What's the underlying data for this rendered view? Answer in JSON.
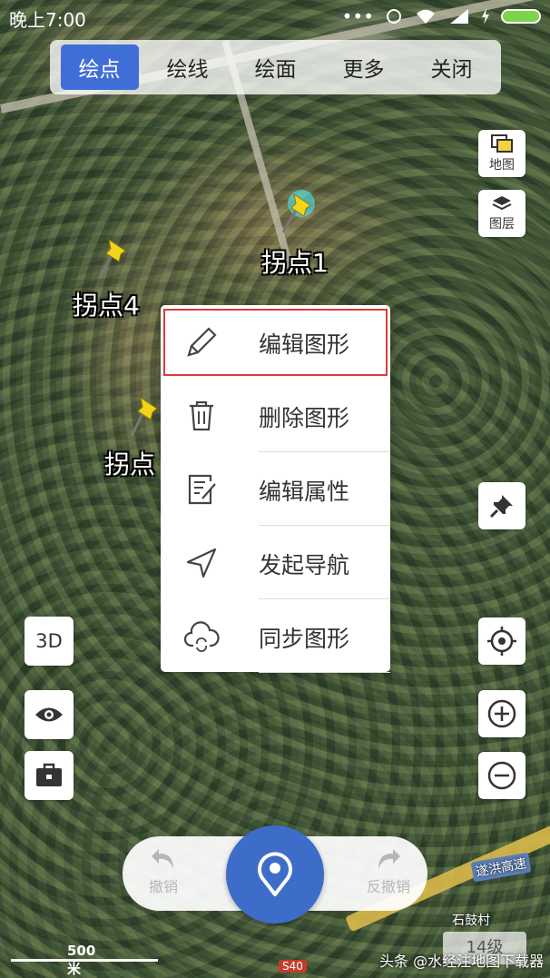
{
  "statusbar": {
    "time": "晚上7:00",
    "dots": "•••"
  },
  "toolbar": {
    "items": [
      "绘点",
      "绘线",
      "绘面",
      "更多",
      "关闭"
    ],
    "active_index": 0
  },
  "side": {
    "map_label": "地图",
    "layer_label": "图层"
  },
  "pins": [
    {
      "label": "拐点1"
    },
    {
      "label": "拐点4"
    },
    {
      "label": "拐点"
    }
  ],
  "menu": {
    "items": [
      "编辑图形",
      "删除图形",
      "编辑属性",
      "发起导航",
      "同步图形"
    ]
  },
  "left": {
    "three_d_label": "3D"
  },
  "bottom": {
    "undo_label": "撤销",
    "redo_label": "反撤销"
  },
  "scale_label": "500米",
  "zoom_level_label": "14级",
  "watermark": "头条 @水经注地图下载器",
  "map_labels": {
    "highway": "遂洪高速",
    "village": "石鼓村",
    "road_shield": "S40"
  },
  "colors": {
    "accent": "#3f6fd6",
    "highlight": "#e03a3a",
    "pin": "#f2d51a"
  }
}
